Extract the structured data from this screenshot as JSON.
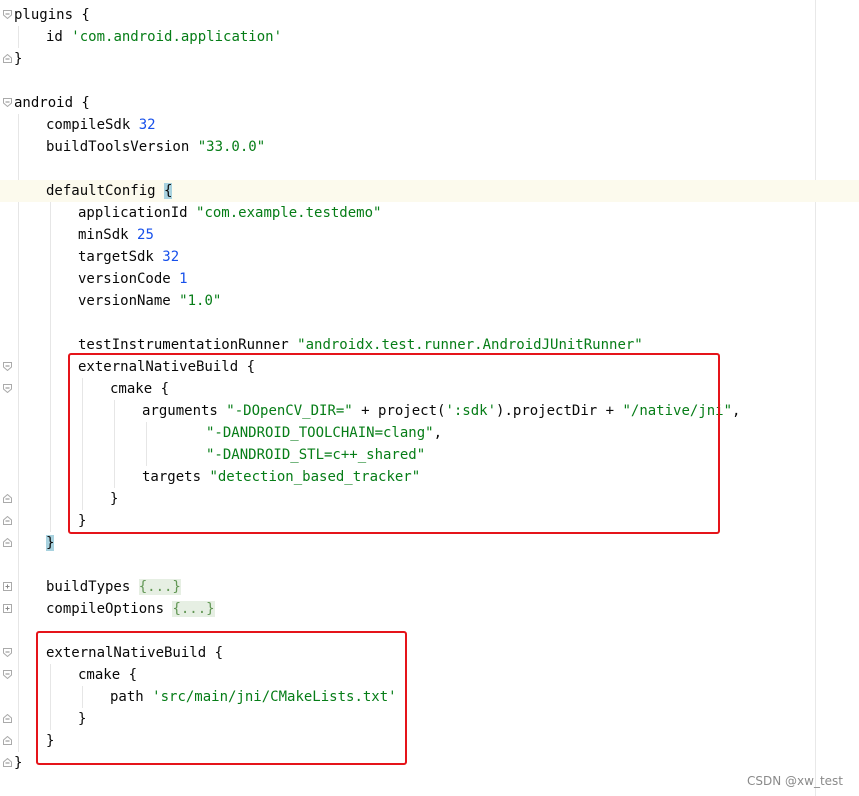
{
  "lines": [
    [
      {
        "t": "plugins {",
        "c": "kw"
      }
    ],
    [
      {
        "t": "id ",
        "c": "kw"
      },
      {
        "t": "'com.android.application'",
        "c": "str"
      }
    ],
    [
      {
        "t": "}",
        "c": "kw"
      }
    ],
    [],
    [
      {
        "t": "android {",
        "c": "kw"
      }
    ],
    [
      {
        "t": "compileSdk ",
        "c": "kw"
      },
      {
        "t": "32",
        "c": "num"
      }
    ],
    [
      {
        "t": "buildToolsVersion ",
        "c": "kw"
      },
      {
        "t": "\"33.0.0\"",
        "c": "str"
      }
    ],
    [],
    [
      {
        "t": "defaultConfig ",
        "c": "kw"
      },
      {
        "t": "{",
        "c": "caret-br"
      }
    ],
    [
      {
        "t": "applicationId ",
        "c": "kw"
      },
      {
        "t": "\"com.example.testdemo\"",
        "c": "str"
      }
    ],
    [
      {
        "t": "minSdk ",
        "c": "kw"
      },
      {
        "t": "25",
        "c": "num"
      }
    ],
    [
      {
        "t": "targetSdk ",
        "c": "kw"
      },
      {
        "t": "32",
        "c": "num"
      }
    ],
    [
      {
        "t": "versionCode ",
        "c": "kw"
      },
      {
        "t": "1",
        "c": "num"
      }
    ],
    [
      {
        "t": "versionName ",
        "c": "kw"
      },
      {
        "t": "\"1.0\"",
        "c": "str"
      }
    ],
    [],
    [
      {
        "t": "testInstrumentationRunner ",
        "c": "kw"
      },
      {
        "t": "\"androidx.test.runner.AndroidJUnitRunner\"",
        "c": "str"
      }
    ],
    [
      {
        "t": "externalNativeBuild {",
        "c": "kw"
      }
    ],
    [
      {
        "t": "cmake {",
        "c": "kw"
      }
    ],
    [
      {
        "t": "arguments ",
        "c": "kw"
      },
      {
        "t": "\"-DOpenCV_DIR=\"",
        "c": "str"
      },
      {
        "t": " + project(",
        "c": "kw"
      },
      {
        "t": "':sdk'",
        "c": "str"
      },
      {
        "t": ").projectDir + ",
        "c": "kw"
      },
      {
        "t": "\"/native/jni\"",
        "c": "str"
      },
      {
        "t": ",",
        "c": "kw"
      }
    ],
    [
      {
        "t": "\"-DANDROID_TOOLCHAIN=clang\"",
        "c": "str"
      },
      {
        "t": ",",
        "c": "kw"
      }
    ],
    [
      {
        "t": "\"-DANDROID_STL=c++_shared\"",
        "c": "str"
      }
    ],
    [
      {
        "t": "targets ",
        "c": "kw"
      },
      {
        "t": "\"detection_based_tracker\"",
        "c": "str"
      }
    ],
    [
      {
        "t": "}",
        "c": "kw"
      }
    ],
    [
      {
        "t": "}",
        "c": "kw"
      }
    ],
    [
      {
        "t": "}",
        "c": "caret-br"
      }
    ],
    [],
    [
      {
        "t": "buildTypes ",
        "c": "kw"
      },
      {
        "t": "{...}",
        "c": "fold"
      }
    ],
    [
      {
        "t": "compileOptions ",
        "c": "kw"
      },
      {
        "t": "{...}",
        "c": "fold"
      }
    ],
    [],
    [
      {
        "t": "externalNativeBuild {",
        "c": "kw"
      }
    ],
    [
      {
        "t": "cmake {",
        "c": "kw"
      }
    ],
    [
      {
        "t": "path ",
        "c": "kw"
      },
      {
        "t": "'src/main/jni/CMakeLists.txt'",
        "c": "str"
      }
    ],
    [
      {
        "t": "}",
        "c": "kw"
      }
    ],
    [
      {
        "t": "}",
        "c": "kw"
      }
    ],
    [
      {
        "t": "}",
        "c": "kw"
      }
    ]
  ],
  "watermark": "CSDN @xw_test",
  "colors": {
    "keyword": "#080808",
    "string": "#067d17",
    "number": "#1750eb",
    "annotation_box": "#e5141a",
    "current_line": "#fcfaed",
    "brace_match": "#a8d2df"
  }
}
